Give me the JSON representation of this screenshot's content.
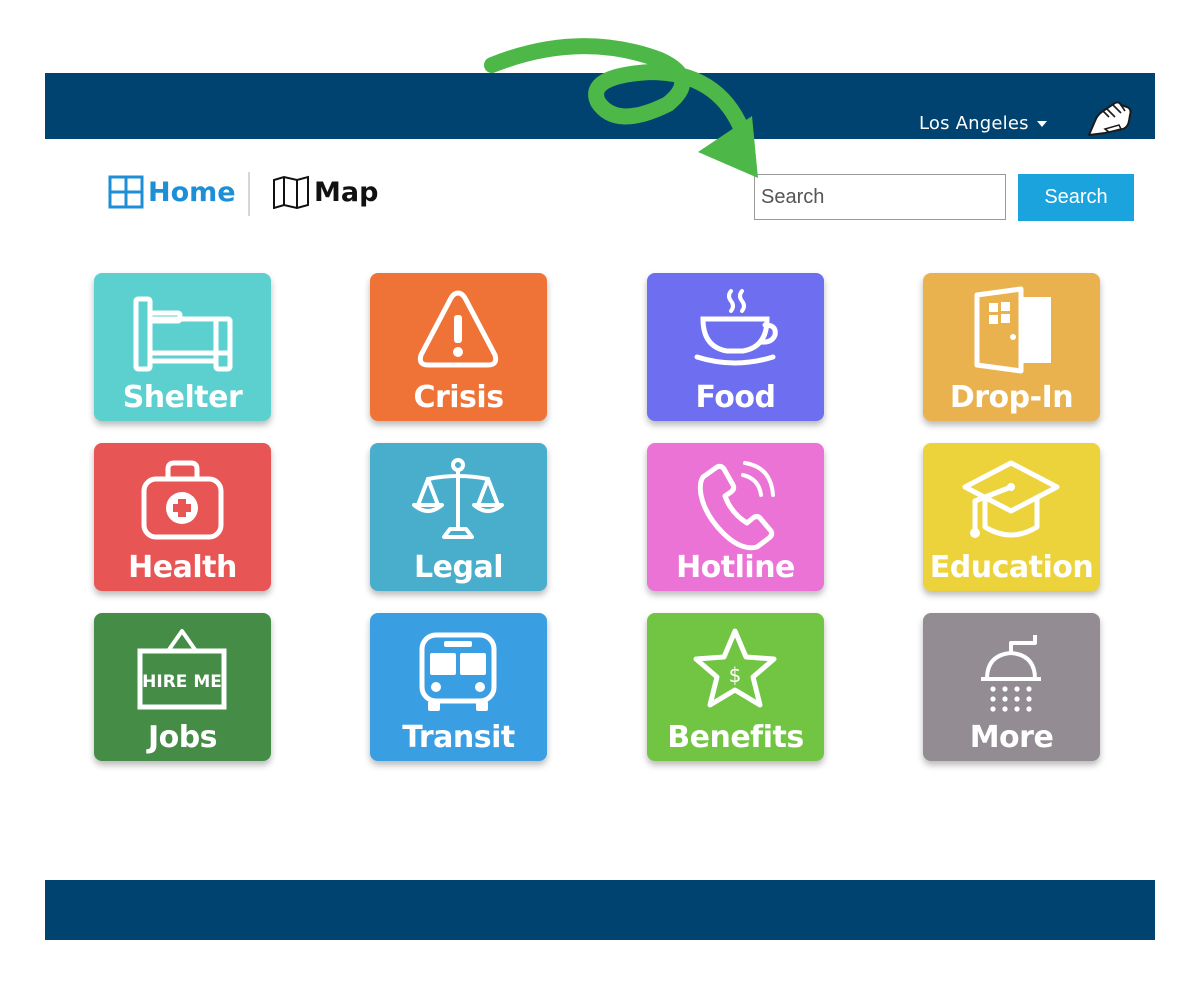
{
  "header": {
    "city": "Los Angeles",
    "bar_color": "#004370"
  },
  "nav": {
    "home_label": "Home",
    "map_label": "Map"
  },
  "search": {
    "placeholder": "Search",
    "button_label": "Search"
  },
  "tiles": [
    {
      "label": "Shelter",
      "icon": "bed-icon",
      "color": "#5ccfcf"
    },
    {
      "label": "Crisis",
      "icon": "warning-icon",
      "color": "#ef7337"
    },
    {
      "label": "Food",
      "icon": "coffee-cup-icon",
      "color": "#6d6ef0"
    },
    {
      "label": "Drop-In",
      "icon": "door-icon",
      "color": "#e9b24f"
    },
    {
      "label": "Health",
      "icon": "medical-kit-icon",
      "color": "#e85555"
    },
    {
      "label": "Legal",
      "icon": "scales-icon",
      "color": "#49aecb"
    },
    {
      "label": "Hotline",
      "icon": "phone-icon",
      "color": "#ea73d5"
    },
    {
      "label": "Education",
      "icon": "graduation-cap-icon",
      "color": "#ecd33c"
    },
    {
      "label": "Jobs",
      "icon": "hire-me-sign-icon",
      "color": "#458c47",
      "icon_text": "HIRE ME"
    },
    {
      "label": "Transit",
      "icon": "bus-icon",
      "color": "#3a9ee2"
    },
    {
      "label": "Benefits",
      "icon": "star-dollar-icon",
      "color": "#72c443",
      "icon_text": "$"
    },
    {
      "label": "More",
      "icon": "shower-icon",
      "color": "#938c93"
    }
  ],
  "annotation": {
    "arrow_color": "#4db848"
  }
}
